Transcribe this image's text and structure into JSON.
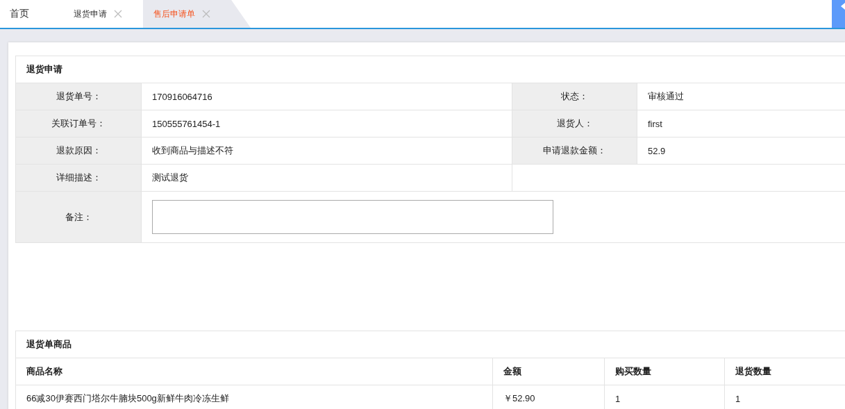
{
  "tabs": [
    {
      "label": "首页",
      "closable": false,
      "selected": false
    },
    {
      "label": "退货申请",
      "closable": true,
      "selected": false
    },
    {
      "label": "售后申请单",
      "closable": true,
      "selected": true
    }
  ],
  "application": {
    "title": "退货申请",
    "rows": [
      [
        {
          "label": "退货单号：",
          "value": "170916064716"
        },
        {
          "label": "状态：",
          "value": "审核通过"
        }
      ],
      [
        {
          "label": "关联订单号：",
          "value": "150555761454-1"
        },
        {
          "label": "退货人：",
          "value": "first"
        }
      ],
      [
        {
          "label": "退款原因：",
          "value": "收到商品与描述不符"
        },
        {
          "label": "申请退款金额：",
          "value": "52.9"
        }
      ],
      [
        {
          "label": "详细描述：",
          "value": "测试退货"
        }
      ]
    ],
    "remark": {
      "label": "备注："
    }
  },
  "goods": {
    "title": "退货单商品",
    "columns": [
      "商品名称",
      "金额",
      "购买数量",
      "退货数量"
    ],
    "rows": [
      [
        "66减30伊赛西门塔尔牛腩块500g新鲜牛肉冷冻生鲜",
        "￥52.90",
        "1",
        "1"
      ]
    ]
  }
}
